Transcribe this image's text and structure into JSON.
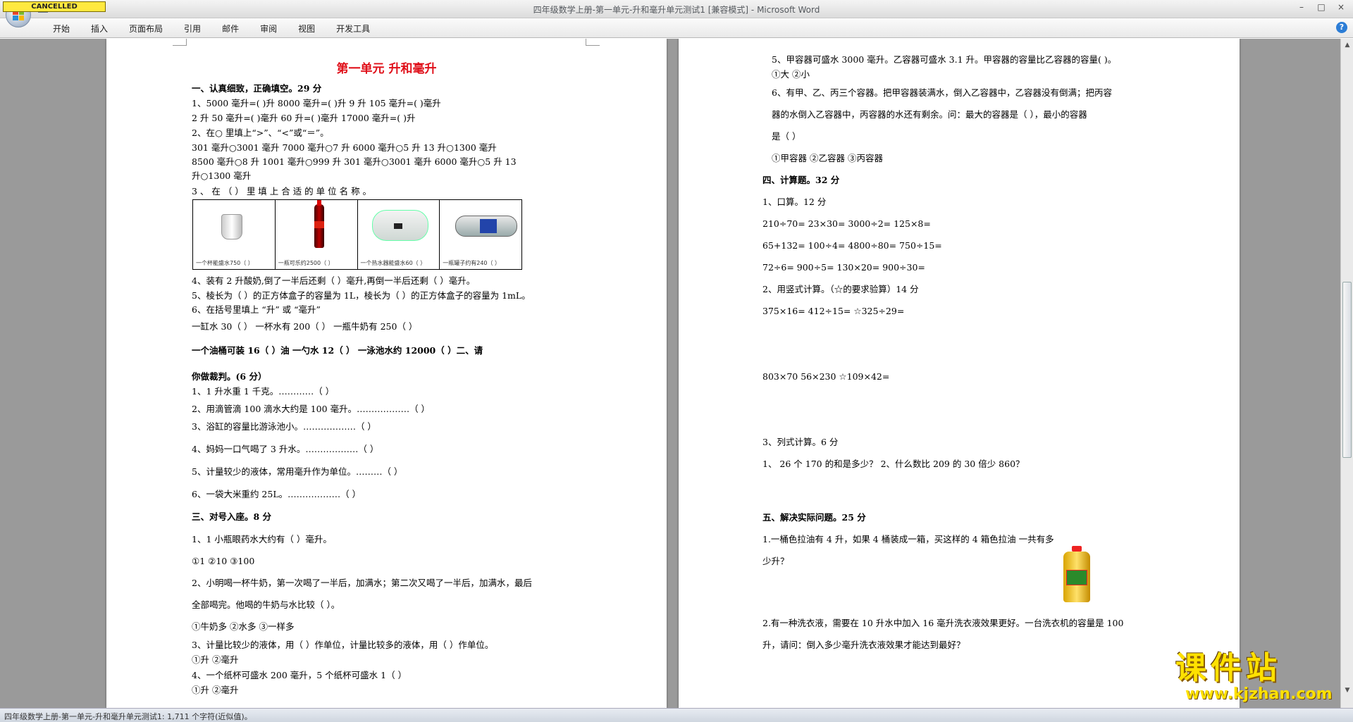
{
  "window": {
    "title": "四年级数学上册-第一单元-升和毫升单元测试1 [兼容模式] - Microsoft Word",
    "stamp": "CANCELLED",
    "controls": [
      "–",
      "□",
      "×"
    ]
  },
  "ribbon": {
    "tabs": [
      "开始",
      "插入",
      "页面布局",
      "引用",
      "邮件",
      "审阅",
      "视图",
      "开发工具"
    ],
    "help": "?"
  },
  "left_page": {
    "title": "第一单元  升和毫升",
    "lines": [
      "一、认真细致，正确填空。29 分",
      "1、5000 毫升=(      )升    8000 毫升=(      )升     9 升 105 毫升=(      )毫升",
      "2 升 50 毫升=(      )毫升    60 升=(      )毫升       17000 毫升=(      )升",
      "2、在○ 里填上“>”、“<”或“＝”。",
      "    301 毫升○3001 毫升    7000 毫升○7 升      6000 毫升○5 升    13 升○1300 毫升",
      "8500 毫升○8 升      1001 毫升○999 升      301 毫升○3001 毫升    6000 毫升○5 升        13",
      "升○1300 毫升",
      "3   、   在   （          ）   里   填   上   合   适   的   单   位   名   称   。",
      "4、装有 2 升酸奶,倒了一半后还剩（      ）毫升,再倒一半后还剩（      ）毫升。",
      "5、棱长为（      ）的正方体盒子的容量为 1L，棱长为（      ）的正方体盒子的容量为 1mL。",
      "6、在括号里填上 “升” 或 “毫升”",
      "  一缸水 30（          ）      一杯水有 200（      ）      一瓶牛奶有 250（        ）",
      "  一个油桶可装 16（      ）油      一勺水 12（      ）      一泳池水约 12000（        ）二、请",
      "你做裁判。(6 分）",
      "1、1 升水重 1 千克。…………（      ）",
      "2、用滴管滴 100 滴水大约是 100 毫升。………………（    ）",
      "    3、浴缸的容量比游泳池小。………………（      ）",
      "    4、妈妈一口气喝了 3 升水。………………（      ）",
      "    5、计量较少的液体，常用毫升作为单位。………（    ）",
      "    6、一袋大米重约 25L。………………（      ）",
      "    三、对号入座。8 分",
      "  1、1 小瓶眼药水大约有（  ）毫升。",
      "         ①1          ②10          ③100",
      "  2、小明喝一杯牛奶，第一次喝了一半后，加满水；第二次又喝了一半后，加满水，最后",
      "    全部喝完。他喝的牛奶与水比较（ ）。",
      "       ①牛奶多        ②水多          ③一样多",
      "  3、计量比较少的液体，用（  ）作单位，计量比较多的液体，用（  ）作单位。",
      "        ①升                                    ②毫升",
      "  4、一个纸杯可盛水 200 毫升，5 个纸杯可盛水 1（      ）",
      "      ①升                                ②毫升"
    ],
    "captions": [
      "一个杯能盛水750（  ）",
      "一瓶可乐约2500（  ）",
      "一个热水器能盛水60（  ）",
      "一瓶罐子约有240（  ）"
    ]
  },
  "right_page": {
    "lines": [
      "5、甲容器可盛水 3000 毫升。乙容器可盛水 3.1 升。甲容器的容量比乙容器的容量(          )。",
      "    ①大            ②小",
      "6、有甲、乙、丙三个容器。把甲容器装满水，倒入乙容器中，乙容器没有倒满；把丙容",
      "器的水倒入乙容器中，丙容器的水还有剩余。问：最大的容器是（      ），最小的容器",
      "是（          ）",
      "  ①甲容器          ②乙容器          ③丙容器",
      "四、计算题。32 分",
      "1、口算。12 分",
      "  210÷70=              23×30=              3000÷2=              125×8=",
      "  65+132=              100÷4=              4800÷80=              750÷15=",
      "    72÷6=                    900÷5=             130×20=             900÷30=",
      "2、用竖式计算。（☆的要求验算）14 分",
      "    375×16=                       412÷15=                         ☆325÷29=",
      "  803×70                  56×230                   ☆109×42=",
      "3、列式计算。6 分",
      "  1、  26 个 170 的和是多少？            2、什么数比 209 的 30 倍少 860？",
      "五、解决实际问题。25 分",
      "1.一桶色拉油有 4 升，如果 4 桶装成一箱，买这样的 4 箱色拉油                 一共有多",
      "少升？",
      "2.有一种洗衣液，需要在 10 升水中加入 16 毫升洗衣液效果更好。一台洗衣机的容量是 100",
      "升，请问：倒入多少毫升洗衣液效果才能达到最好？"
    ]
  },
  "statusbar": {
    "text": "四年级数学上册-第一单元-升和毫升单元测试1: 1,711 个字符(近似值)。"
  },
  "watermark": {
    "cn": "课件站",
    "url": "www.kjzhan.com"
  }
}
